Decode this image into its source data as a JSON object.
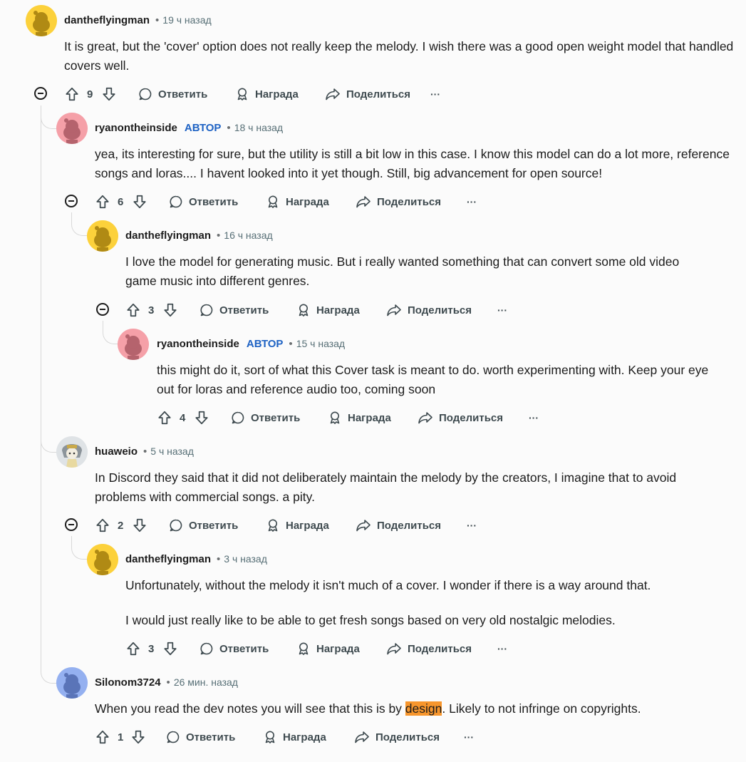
{
  "actions": {
    "reply": "Ответить",
    "award": "Награда",
    "share": "Поделиться",
    "more": "···"
  },
  "op_badge": "АВТОР",
  "comments": [
    {
      "author": "dantheflyingman",
      "time": "19 ч назад",
      "avatar": "yellow-snoo",
      "body": [
        "It is great, but the 'cover' option does not really keep the melody. I wish there was a good open weight model that handled covers well."
      ],
      "votes": "9"
    },
    {
      "author": "ryanontheinside",
      "op": true,
      "time": "18 ч назад",
      "avatar": "pink-snoo",
      "body": [
        "yea, its interesting for sure, but the utility is still a bit low in this case. I know this model can do a lot more, reference songs and loras.... I havent looked into it yet though. Still, big advancement for open source!"
      ],
      "votes": "6"
    },
    {
      "author": "dantheflyingman",
      "time": "16 ч назад",
      "avatar": "yellow-snoo",
      "body": [
        "I love the model for generating music. But i really wanted something that can convert some old video game music into different genres."
      ],
      "votes": "3"
    },
    {
      "author": "ryanontheinside",
      "op": true,
      "time": "15 ч назад",
      "avatar": "pink-snoo",
      "body": [
        "this might do it, sort of what this Cover task is meant to do. worth experimenting with. Keep your eye out for loras and reference audio too, coming soon"
      ],
      "votes": "4"
    },
    {
      "author": "huaweio",
      "time": "5 ч назад",
      "avatar": "custom-avatar",
      "body": [
        "In Discord they said that it did not deliberately maintain the melody by the creators, I imagine that to avoid problems with commercial songs. a pity."
      ],
      "votes": "2"
    },
    {
      "author": "dantheflyingman",
      "time": "3 ч назад",
      "avatar": "yellow-snoo",
      "body": [
        "Unfortunately, without the melody it isn't much of a cover. I wonder if there is a way around that.",
        "I would just really like to be able to get fresh songs based on very old nostalgic melodies."
      ],
      "votes": "3"
    },
    {
      "author": "Silonom3724",
      "time": "26 мин. назад",
      "avatar": "blue-snoo",
      "body_before": "When you read the dev notes you will see that this is by ",
      "body_highlight": "design",
      "body_after": ". Likely to not infringe on copyrights.",
      "votes": "1"
    }
  ],
  "colors": {
    "yellow_avatar_bg": "#fcd13b",
    "pink_avatar_bg": "#f5a0a8",
    "blue_avatar_bg": "#94b0f0",
    "op_badge": "#1f63c4",
    "highlight": "#f7962d"
  }
}
